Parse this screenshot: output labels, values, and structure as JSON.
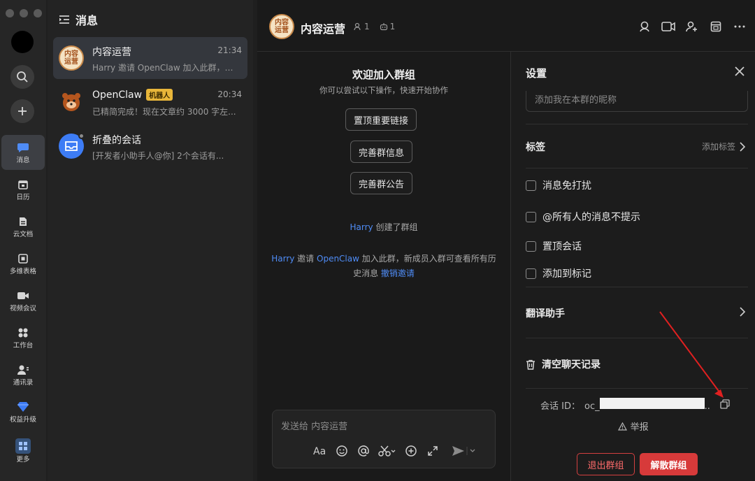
{
  "rail": {
    "items": [
      {
        "label": "消息",
        "icon": "message-icon",
        "active": true
      },
      {
        "label": "日历",
        "icon": "calendar-icon"
      },
      {
        "label": "云文档",
        "icon": "cloud-doc-icon"
      },
      {
        "label": "多维表格",
        "icon": "base-table-icon"
      },
      {
        "label": "视频会议",
        "icon": "video-meeting-icon"
      },
      {
        "label": "工作台",
        "icon": "workplace-icon"
      },
      {
        "label": "通讯录",
        "icon": "contacts-icon"
      },
      {
        "label": "权益升级",
        "icon": "upgrade-gem-icon"
      },
      {
        "label": "更多",
        "icon": "more-apps-icon"
      }
    ]
  },
  "conversations": {
    "title": "消息",
    "items": [
      {
        "name": "内容运营",
        "time": "21:34",
        "preview": "Harry 邀请 OpenClaw 加入此群，新...",
        "avatar_text": "内容\n运营"
      },
      {
        "name": "OpenClaw",
        "badge": "机器人",
        "time": "20:34",
        "preview": "已精简完成！现在文章约 3000 字左..."
      },
      {
        "name": "折叠的会话",
        "preview": "[开发者小助手人@你] 2个会话有..."
      }
    ]
  },
  "chat": {
    "title": "内容运营",
    "members_count": "1",
    "bots_count": "1",
    "avatar_text": "内容\n运营",
    "welcome_title": "欢迎加入群组",
    "welcome_sub": "你可以尝试以下操作，快速开始协作",
    "actions": [
      "置顶重要链接",
      "完善群信息",
      "完善群公告"
    ],
    "sys_created": {
      "user": "Harry",
      "text": " 创建了群组"
    },
    "sys_invite": {
      "user": "Harry",
      "mid": " 邀请 ",
      "bot": "OpenClaw",
      "text": " 加入此群，新成员入群可查看所有历史消息 ",
      "revoke": "撤销邀请"
    },
    "composer_placeholder": "发送给 内容运营"
  },
  "settings": {
    "title": "设置",
    "nickname_placeholder": "添加我在本群的昵称",
    "tags_label": "标签",
    "tags_action": "添加标签",
    "checks": [
      "消息免打扰",
      "@所有人的消息不提示",
      "置顶会话",
      "添加到标记"
    ],
    "translate_label": "翻译助手",
    "clear_label": "清空聊天记录",
    "chat_id_label": "会话 ID：",
    "chat_id_prefix": "oc_",
    "chat_id_suffix": "..",
    "report_label": "举报",
    "leave_label": "退出群组",
    "dissolve_label": "解散群组"
  },
  "colors": {
    "accent_link": "#4f8cf6",
    "danger": "#d73a3a",
    "annotation_arrow": "#e02020"
  }
}
